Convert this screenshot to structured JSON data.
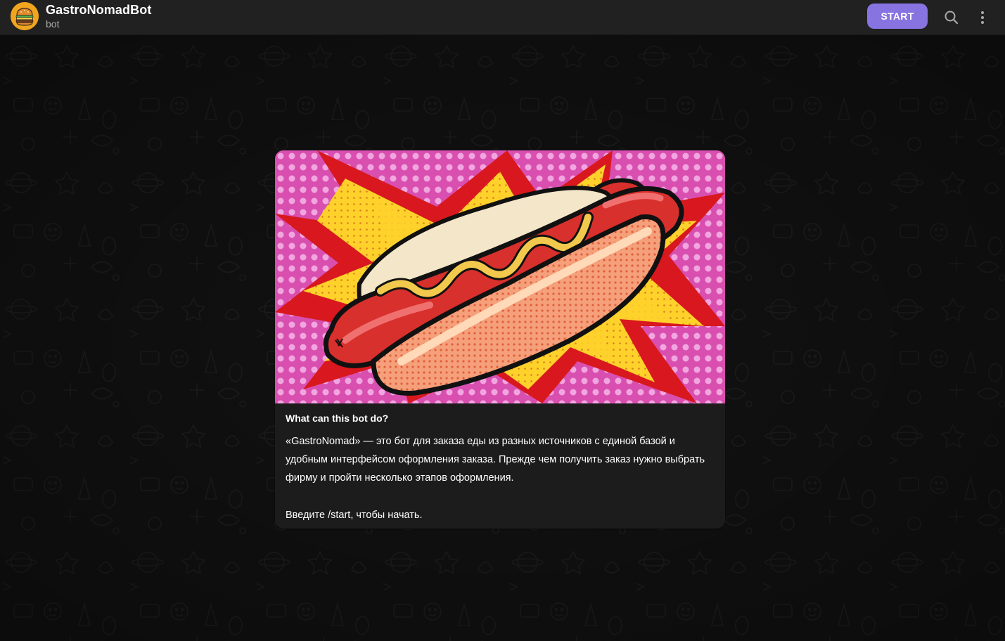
{
  "header": {
    "title": "GastroNomadBot",
    "subtitle": "bot",
    "start_label": "START",
    "avatar_icon": "burger-icon",
    "search_icon": "search-icon",
    "menu_icon": "more-vertical-icon"
  },
  "bot_info": {
    "heading": "What can this bot do?",
    "description": "«GastroNomad» — это бот для заказа еды из разных источников с единой базой и удобным интерфейсом оформления заказа. Прежде чем получить заказ нужно выбрать фирму и пройти несколько этапов оформления.",
    "hint": "Введите /start, чтобы начать.",
    "image_icon": "hot-dog-illustration"
  },
  "colors": {
    "header_bg": "#212121",
    "accent": "#8774e1",
    "chat_bg": "#0f0f0f",
    "card_bg": "#1c1c1c"
  }
}
